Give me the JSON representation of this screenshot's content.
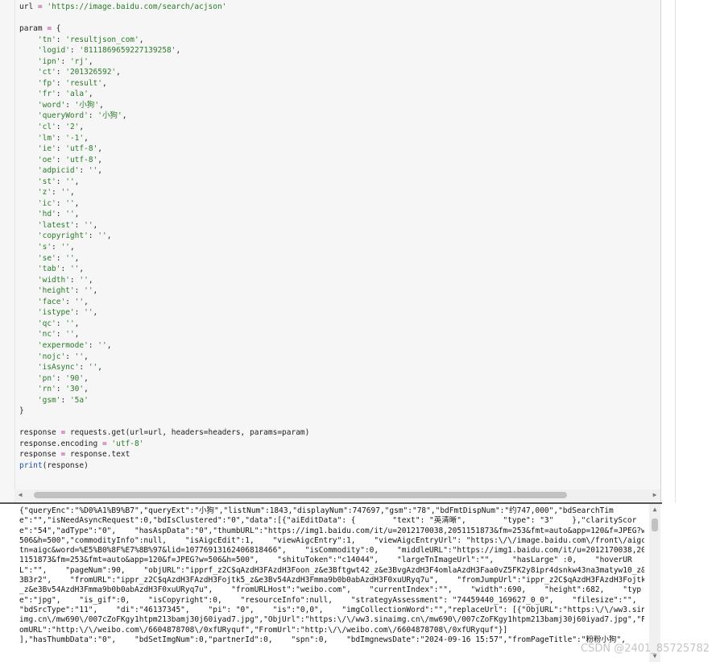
{
  "editor": {
    "lines": [
      [
        {
          "t": "url ",
          "c": ""
        },
        {
          "t": "= ",
          "c": "op"
        },
        {
          "t": "'https://image.baidu.com/search/acjson'",
          "c": "str"
        }
      ],
      [],
      [
        {
          "t": "param ",
          "c": ""
        },
        {
          "t": "= ",
          "c": "op"
        },
        {
          "t": "{",
          "c": "brk"
        }
      ],
      [
        {
          "t": "    'tn'",
          "c": "str"
        },
        {
          "t": ": ",
          "c": ""
        },
        {
          "t": "'resultjson_com'",
          "c": "str"
        },
        {
          "t": ",",
          "c": ""
        }
      ],
      [
        {
          "t": "    'logid'",
          "c": "str"
        },
        {
          "t": ": ",
          "c": ""
        },
        {
          "t": "'8111869659227139258'",
          "c": "str"
        },
        {
          "t": ",",
          "c": ""
        }
      ],
      [
        {
          "t": "    'ipn'",
          "c": "str"
        },
        {
          "t": ": ",
          "c": ""
        },
        {
          "t": "'rj'",
          "c": "str"
        },
        {
          "t": ",",
          "c": ""
        }
      ],
      [
        {
          "t": "    'ct'",
          "c": "str"
        },
        {
          "t": ": ",
          "c": ""
        },
        {
          "t": "'201326592'",
          "c": "str"
        },
        {
          "t": ",",
          "c": ""
        }
      ],
      [
        {
          "t": "    'fp'",
          "c": "str"
        },
        {
          "t": ": ",
          "c": ""
        },
        {
          "t": "'result'",
          "c": "str"
        },
        {
          "t": ",",
          "c": ""
        }
      ],
      [
        {
          "t": "    'fr'",
          "c": "str"
        },
        {
          "t": ": ",
          "c": ""
        },
        {
          "t": "'ala'",
          "c": "str"
        },
        {
          "t": ",",
          "c": ""
        }
      ],
      [
        {
          "t": "    'word'",
          "c": "str"
        },
        {
          "t": ": ",
          "c": ""
        },
        {
          "t": "'小狗'",
          "c": "str"
        },
        {
          "t": ",",
          "c": ""
        }
      ],
      [
        {
          "t": "    'queryWord'",
          "c": "str"
        },
        {
          "t": ": ",
          "c": ""
        },
        {
          "t": "'小狗'",
          "c": "str"
        },
        {
          "t": ",",
          "c": ""
        }
      ],
      [
        {
          "t": "    'cl'",
          "c": "str"
        },
        {
          "t": ": ",
          "c": ""
        },
        {
          "t": "'2'",
          "c": "str"
        },
        {
          "t": ",",
          "c": ""
        }
      ],
      [
        {
          "t": "    'lm'",
          "c": "str"
        },
        {
          "t": ": ",
          "c": ""
        },
        {
          "t": "'-1'",
          "c": "str"
        },
        {
          "t": ",",
          "c": ""
        }
      ],
      [
        {
          "t": "    'ie'",
          "c": "str"
        },
        {
          "t": ": ",
          "c": ""
        },
        {
          "t": "'utf-8'",
          "c": "str"
        },
        {
          "t": ",",
          "c": ""
        }
      ],
      [
        {
          "t": "    'oe'",
          "c": "str"
        },
        {
          "t": ": ",
          "c": ""
        },
        {
          "t": "'utf-8'",
          "c": "str"
        },
        {
          "t": ",",
          "c": ""
        }
      ],
      [
        {
          "t": "    'adpicid'",
          "c": "str"
        },
        {
          "t": ": ",
          "c": ""
        },
        {
          "t": "''",
          "c": "str"
        },
        {
          "t": ",",
          "c": ""
        }
      ],
      [
        {
          "t": "    'st'",
          "c": "str"
        },
        {
          "t": ": ",
          "c": ""
        },
        {
          "t": "''",
          "c": "str"
        },
        {
          "t": ",",
          "c": ""
        }
      ],
      [
        {
          "t": "    'z'",
          "c": "str"
        },
        {
          "t": ": ",
          "c": ""
        },
        {
          "t": "''",
          "c": "str"
        },
        {
          "t": ",",
          "c": ""
        }
      ],
      [
        {
          "t": "    'ic'",
          "c": "str"
        },
        {
          "t": ": ",
          "c": ""
        },
        {
          "t": "''",
          "c": "str"
        },
        {
          "t": ",",
          "c": ""
        }
      ],
      [
        {
          "t": "    'hd'",
          "c": "str"
        },
        {
          "t": ": ",
          "c": ""
        },
        {
          "t": "''",
          "c": "str"
        },
        {
          "t": ",",
          "c": ""
        }
      ],
      [
        {
          "t": "    'latest'",
          "c": "str"
        },
        {
          "t": ": ",
          "c": ""
        },
        {
          "t": "''",
          "c": "str"
        },
        {
          "t": ",",
          "c": ""
        }
      ],
      [
        {
          "t": "    'copyright'",
          "c": "str"
        },
        {
          "t": ": ",
          "c": ""
        },
        {
          "t": "''",
          "c": "str"
        },
        {
          "t": ",",
          "c": ""
        }
      ],
      [
        {
          "t": "    's'",
          "c": "str"
        },
        {
          "t": ": ",
          "c": ""
        },
        {
          "t": "''",
          "c": "str"
        },
        {
          "t": ",",
          "c": ""
        }
      ],
      [
        {
          "t": "    'se'",
          "c": "str"
        },
        {
          "t": ": ",
          "c": ""
        },
        {
          "t": "''",
          "c": "str"
        },
        {
          "t": ",",
          "c": ""
        }
      ],
      [
        {
          "t": "    'tab'",
          "c": "str"
        },
        {
          "t": ": ",
          "c": ""
        },
        {
          "t": "''",
          "c": "str"
        },
        {
          "t": ",",
          "c": ""
        }
      ],
      [
        {
          "t": "    'width'",
          "c": "str"
        },
        {
          "t": ": ",
          "c": ""
        },
        {
          "t": "''",
          "c": "str"
        },
        {
          "t": ",",
          "c": ""
        }
      ],
      [
        {
          "t": "    'height'",
          "c": "str"
        },
        {
          "t": ": ",
          "c": ""
        },
        {
          "t": "''",
          "c": "str"
        },
        {
          "t": ",",
          "c": ""
        }
      ],
      [
        {
          "t": "    'face'",
          "c": "str"
        },
        {
          "t": ": ",
          "c": ""
        },
        {
          "t": "''",
          "c": "str"
        },
        {
          "t": ",",
          "c": ""
        }
      ],
      [
        {
          "t": "    'istype'",
          "c": "str"
        },
        {
          "t": ": ",
          "c": ""
        },
        {
          "t": "''",
          "c": "str"
        },
        {
          "t": ",",
          "c": ""
        }
      ],
      [
        {
          "t": "    'qc'",
          "c": "str"
        },
        {
          "t": ": ",
          "c": ""
        },
        {
          "t": "''",
          "c": "str"
        },
        {
          "t": ",",
          "c": ""
        }
      ],
      [
        {
          "t": "    'nc'",
          "c": "str"
        },
        {
          "t": ": ",
          "c": ""
        },
        {
          "t": "''",
          "c": "str"
        },
        {
          "t": ",",
          "c": ""
        }
      ],
      [
        {
          "t": "    'expermode'",
          "c": "str"
        },
        {
          "t": ": ",
          "c": ""
        },
        {
          "t": "''",
          "c": "str"
        },
        {
          "t": ",",
          "c": ""
        }
      ],
      [
        {
          "t": "    'nojc'",
          "c": "str"
        },
        {
          "t": ": ",
          "c": ""
        },
        {
          "t": "''",
          "c": "str"
        },
        {
          "t": ",",
          "c": ""
        }
      ],
      [
        {
          "t": "    'isAsync'",
          "c": "str"
        },
        {
          "t": ": ",
          "c": ""
        },
        {
          "t": "''",
          "c": "str"
        },
        {
          "t": ",",
          "c": ""
        }
      ],
      [
        {
          "t": "    'pn'",
          "c": "str"
        },
        {
          "t": ": ",
          "c": ""
        },
        {
          "t": "'90'",
          "c": "str"
        },
        {
          "t": ",",
          "c": ""
        }
      ],
      [
        {
          "t": "    'rn'",
          "c": "str"
        },
        {
          "t": ": ",
          "c": ""
        },
        {
          "t": "'30'",
          "c": "str"
        },
        {
          "t": ",",
          "c": ""
        }
      ],
      [
        {
          "t": "    'gsm'",
          "c": "str"
        },
        {
          "t": ": ",
          "c": ""
        },
        {
          "t": "'5a'",
          "c": "str"
        }
      ],
      [
        {
          "t": "}",
          "c": "brk"
        }
      ],
      [],
      [
        {
          "t": "response ",
          "c": ""
        },
        {
          "t": "= ",
          "c": "op"
        },
        {
          "t": "requests.get(url=url, headers=headers, params=param)",
          "c": ""
        }
      ],
      [
        {
          "t": "response.encoding ",
          "c": ""
        },
        {
          "t": "= ",
          "c": "op"
        },
        {
          "t": "'utf-8'",
          "c": "str"
        }
      ],
      [
        {
          "t": "response ",
          "c": ""
        },
        {
          "t": "= ",
          "c": "op"
        },
        {
          "t": "response.text",
          "c": ""
        }
      ],
      [
        {
          "t": "print",
          "c": "fn"
        },
        {
          "t": "(response)",
          "c": ""
        }
      ]
    ]
  },
  "output": {
    "lines": [
      "{\"queryEnc\":\"%D0%A1%B9%B7\",\"queryExt\":\"小狗\",\"listNum\":1843,\"displayNum\":747697,\"gsm\":\"78\",\"bdFmtDispNum\":\"约747,000\",\"bdSearchTim",
      "e\":\"\",\"isNeedAsyncRequest\":0,\"bdIsClustered\":\"0\",\"data\":[{\"aiEditData\": {        \"text\": \"英清晰\",        \"type\": \"3\"    },\"clarityScor",
      "e\":\"54\",\"adType\":\"0\",    \"hasAspData\":\"0\",\"thumbURL\":\"https://img1.baidu.com/it/u=2012170038,2051151873&fm=253&fmt=auto&app=120&f=JPEG?w=",
      "506&h=500\",\"commodityInfo\":null,    \"isAigcEdit\":1,    \"viewAigcEntry\":1,    \"viewAigcEntryUrl\": \"https:\\/\\/image.baidu.com\\/front\\/aigc?",
      "tn=aigc&word=%E5%B0%8F%E7%8B%97&lid=10776913162406818466\",    \"isCommodity\":0,    \"middleURL\":\"https://img1.baidu.com/it/u=2012170038,205",
      "1151873&fm=253&fmt=auto&app=120&f=JPEG?w=506&h=500\",    \"shituToken\":\"c14044\",    \"largeTnImageUrl\":\"\",    \"hasLarge\" :0,    \"hoverUR",
      "L\":\"\",    \"pageNum\":90,    \"objURL\":\"ipprf_z2C$qAzdH3FAzdH3Foon_z&e3Bftgwt42_z&e3BvgAzdH3F4omlaAzdH3Faa0vZ5FK2y8ipr4dsnkw43na3matyw10_z&e",
      "3B3r2\",    \"fromURL\":\"ippr_z2C$qAzdH3FAzdH3Fojtk5_z&e3Bv54AzdH3Fmma9b0b0abAzdH3F0xuURyq7u\",    \"fromJumpUrl\":\"ippr_z2C$qAzdH3FAzdH3Fojtk5",
      "_z&e3Bv54AzdH3Fmma9b0b0abAzdH3F0xuURyq7u\",    \"fromURLHost\":\"weibo.com\",    \"currentIndex\":\"\",    \"width\":690,    \"height\":682,    \"typ",
      "e\":\"jpg\",    \"is_gif\":0,    \"isCopyright\":0,    \"resourceInfo\":null,    \"strategyAssessment\": \"74459440_169627_0_0\",    \"filesize\":\"\",",
      "\"bdSrcType\":\"11\",    \"di\":\"46137345\",    \"pi\": \"0\",    \"is\":\"0,0\",    \"imgCollectionWord\":\"\",\"replaceUrl\": [{\"ObjURL\":\"https:\\/\\/ww3.sina",
      "img.cn\\/mw690\\/007cZoFKgy1htpm213bamj30j60iyad7.jpg\",\"ObjUrl\":\"https:\\/\\/ww3.sinaimg.cn\\/mw690\\/007cZoFKgy1htpm213bamj30j60iyad7.jpg\",\"Fr",
      "omURL\":\"http:\\/\\/weibo.com\\/6604878708\\/0xfURyquf\",\"FromUrl\":\"http:\\/\\/weibo.com\\/6604878708\\/0xfURyquf\"}]",
      "],\"hasThumbData\":\"0\",    \"bdSetImgNum\":0,\"partnerId\":0,    \"spn\":0,    \"bdImgnewsDate\":\"2024-09-16 15:57\",\"fromPageTitle\":\"粉粉小狗\","
    ]
  },
  "watermark": "CSDN @2401_85725782",
  "colors": {
    "string": "#2a7a2a",
    "operator": "#b32c8a",
    "builtin": "#1f4fb0"
  }
}
